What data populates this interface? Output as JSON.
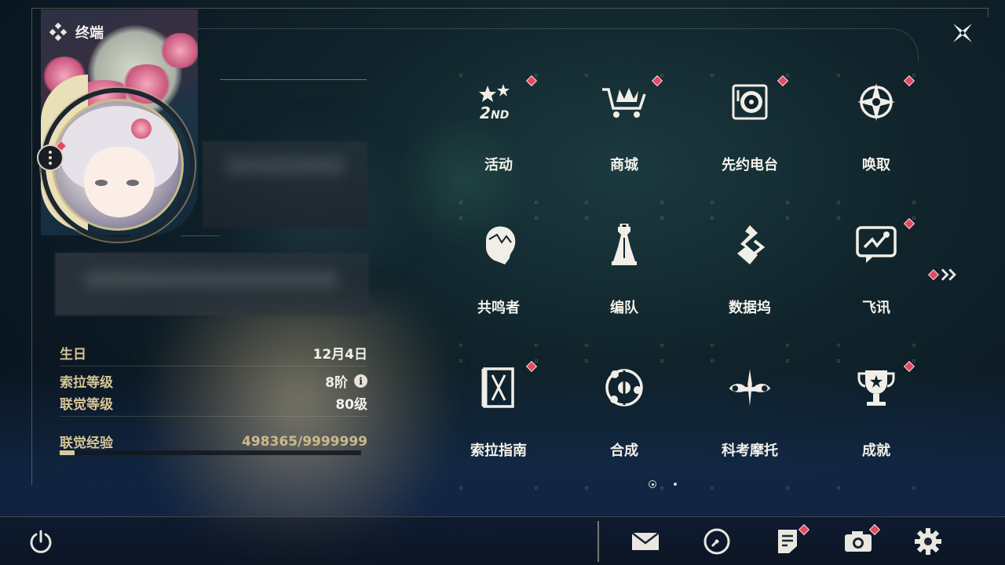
{
  "header": {
    "title": "终端",
    "icon": "diamond-cluster-icon",
    "close_icon": "close-x-icon"
  },
  "profile": {
    "more_icon": "more-vertical-icon",
    "stats": [
      {
        "label": "生日",
        "value": "12月4日"
      },
      {
        "label": "索拉等级",
        "value": "8阶",
        "info": "i"
      },
      {
        "label": "联觉等级",
        "value": "80级"
      }
    ],
    "exp": {
      "label": "联觉经验",
      "value": "498365/9999999",
      "progress": 0.0498
    }
  },
  "menu": {
    "items": [
      {
        "label": "活动",
        "icon": "event-stars-icon",
        "badge": true
      },
      {
        "label": "商城",
        "icon": "shop-cart-icon",
        "badge": true
      },
      {
        "label": "先约电台",
        "icon": "radio-turntable-icon",
        "badge": true
      },
      {
        "label": "唤取",
        "icon": "compass-star-icon",
        "badge": true
      },
      {
        "label": "共鸣者",
        "icon": "character-head-icon",
        "badge": false
      },
      {
        "label": "编队",
        "icon": "chess-team-icon",
        "badge": false
      },
      {
        "label": "数据坞",
        "icon": "data-dock-icon",
        "badge": false
      },
      {
        "label": "飞讯",
        "icon": "message-chat-icon",
        "badge": true
      },
      {
        "label": "索拉指南",
        "icon": "guide-book-icon",
        "badge": true
      },
      {
        "label": "合成",
        "icon": "synthesis-orbit-icon",
        "badge": false
      },
      {
        "label": "科考摩托",
        "icon": "motorbike-icon",
        "badge": false
      },
      {
        "label": "成就",
        "icon": "trophy-icon",
        "badge": true
      }
    ],
    "next_icon": "double-chevron-right-icon",
    "next_badge": true
  },
  "pagination": {
    "current": 1,
    "total": 2
  },
  "bottom_bar": {
    "power_icon": "power-icon",
    "buttons": [
      {
        "name": "mail",
        "icon": "mail-icon",
        "badge": false
      },
      {
        "name": "clock",
        "icon": "clock-icon",
        "badge": false
      },
      {
        "name": "notice",
        "icon": "notice-document-icon",
        "badge": true
      },
      {
        "name": "camera",
        "icon": "camera-icon",
        "badge": true
      },
      {
        "name": "settings",
        "icon": "gear-icon",
        "badge": false
      }
    ]
  },
  "colors": {
    "accent_gold": "#d7c597",
    "badge_red": "#e24a62",
    "text_light": "#f3f1ea",
    "background": "#0b1823"
  }
}
